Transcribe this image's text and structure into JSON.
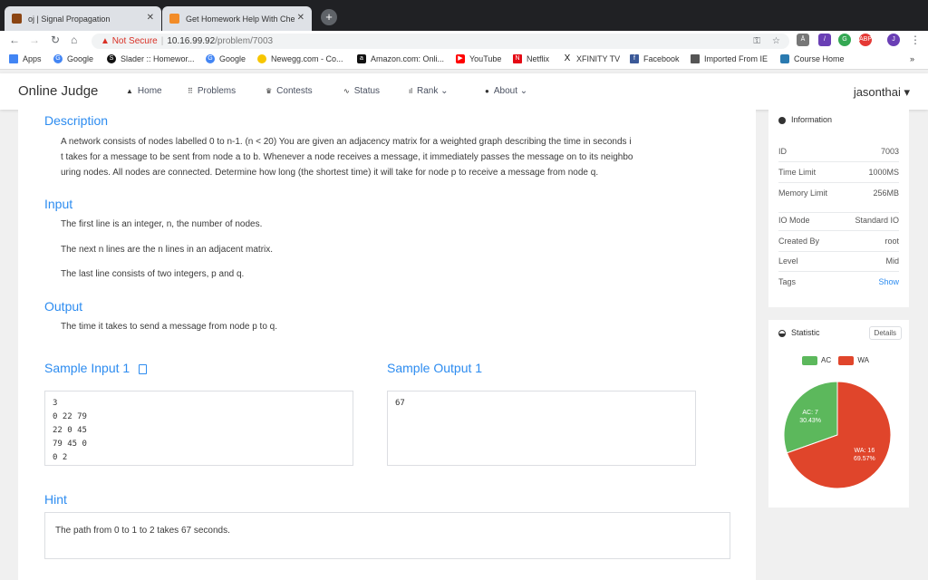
{
  "browser": {
    "tabs": [
      {
        "title": "oj | Signal Propagation",
        "favicon_color": "#8b4513"
      },
      {
        "title": "Get Homework Help With Che",
        "favicon_color": "#f28c28"
      }
    ],
    "new_tab": "+",
    "security": "Not Secure",
    "url_host": "10.16.99.92",
    "url_path": "/problem/7003",
    "bookmarks": [
      {
        "label": "Apps",
        "color": "#4285f4",
        "icon": "apps-icon"
      },
      {
        "label": "Google",
        "color": "#4285f4",
        "icon": "google-icon"
      },
      {
        "label": "Slader :: Homewor...",
        "color": "#111111",
        "icon": "slader-icon"
      },
      {
        "label": "Google",
        "color": "#4285f4",
        "icon": "google-icon"
      },
      {
        "label": "Newegg.com - Co...",
        "color": "#f7c600",
        "icon": "newegg-icon"
      },
      {
        "label": "Amazon.com: Onli...",
        "color": "#111111",
        "icon": "amazon-icon"
      },
      {
        "label": "YouTube",
        "color": "#ff0000",
        "icon": "youtube-icon"
      },
      {
        "label": "Netflix",
        "color": "#e50914",
        "icon": "netflix-icon"
      },
      {
        "label": "XFINITY TV",
        "color": "#111111",
        "icon": "xfinity-icon"
      },
      {
        "label": "Facebook",
        "color": "#3b5998",
        "icon": "facebook-icon"
      },
      {
        "label": "Imported From IE",
        "color": "#555555",
        "icon": "folder-icon"
      },
      {
        "label": "Course Home",
        "color": "#2a7ab0",
        "icon": "course-icon"
      }
    ],
    "more": "»"
  },
  "nav": {
    "logo": "Online Judge",
    "items": [
      {
        "label": "Home",
        "icon": "home-icon",
        "glyph": "▲"
      },
      {
        "label": "Problems",
        "icon": "grid-icon",
        "glyph": "⠿"
      },
      {
        "label": "Contests",
        "icon": "trophy-icon",
        "glyph": "🏆"
      },
      {
        "label": "Status",
        "icon": "pulse-icon",
        "glyph": "∿"
      },
      {
        "label": "Rank ⌄",
        "icon": "bar-chart-icon",
        "glyph": "ıl"
      },
      {
        "label": "About ⌄",
        "icon": "info-icon",
        "glyph": "●"
      }
    ],
    "user": "jasonthai ▾"
  },
  "problem": {
    "description_title": "Description",
    "description_lines": [
      "A network consists of nodes labelled 0 to n-1. (n < 20) You are given an adjacency matrix for a weighted graph describing the time in seconds i",
      "t takes for a message to be sent from node a to b. Whenever a node receives a message, it immediately passes the message on to its neighbo",
      "uring nodes. All nodes are connected. Determine how long (the shortest time) it will take for node p to receive a message from node q."
    ],
    "input_title": "Input",
    "input_lines": [
      "The first line is an integer, n, the number of nodes.",
      "The next n lines are the n lines in an adjacent matrix.",
      "The last line consists of two integers, p and q."
    ],
    "output_title": "Output",
    "output_text": "The time it takes to send a message from node p to q.",
    "sample_input_title": "Sample Input 1",
    "sample_input": "3\n0 22 79\n22 0 45\n79 45 0\n0 2",
    "sample_output_title": "Sample Output 1",
    "sample_output": "67",
    "hint_title": "Hint",
    "hint_text": "The path from 0 to 1 to 2 takes 67 seconds."
  },
  "info": {
    "title": "Information",
    "rows": [
      {
        "label": "ID",
        "value": "7003",
        "link": false
      },
      {
        "label": "Time Limit",
        "value": "1000MS",
        "link": false
      },
      {
        "label": "Memory Limit",
        "value": "256MB",
        "link": false
      },
      {
        "label": "IO Mode",
        "value": "Standard IO",
        "link": false
      },
      {
        "label": "Created By",
        "value": "root",
        "link": false
      },
      {
        "label": "Level",
        "value": "Mid",
        "link": false
      },
      {
        "label": "Tags",
        "value": "Show",
        "link": true
      }
    ]
  },
  "statistic": {
    "title": "Statistic",
    "details_button": "Details",
    "legend": [
      {
        "label": "AC",
        "color": "#5cb85c"
      },
      {
        "label": "WA",
        "color": "#e0452b"
      }
    ],
    "chart_data": {
      "type": "pie",
      "slices": [
        {
          "label": "AC",
          "value": 7,
          "percent": "30.43%",
          "color": "#5cb85c"
        },
        {
          "label": "WA",
          "value": 16,
          "percent": "69.57%",
          "color": "#e0452b"
        }
      ]
    }
  }
}
